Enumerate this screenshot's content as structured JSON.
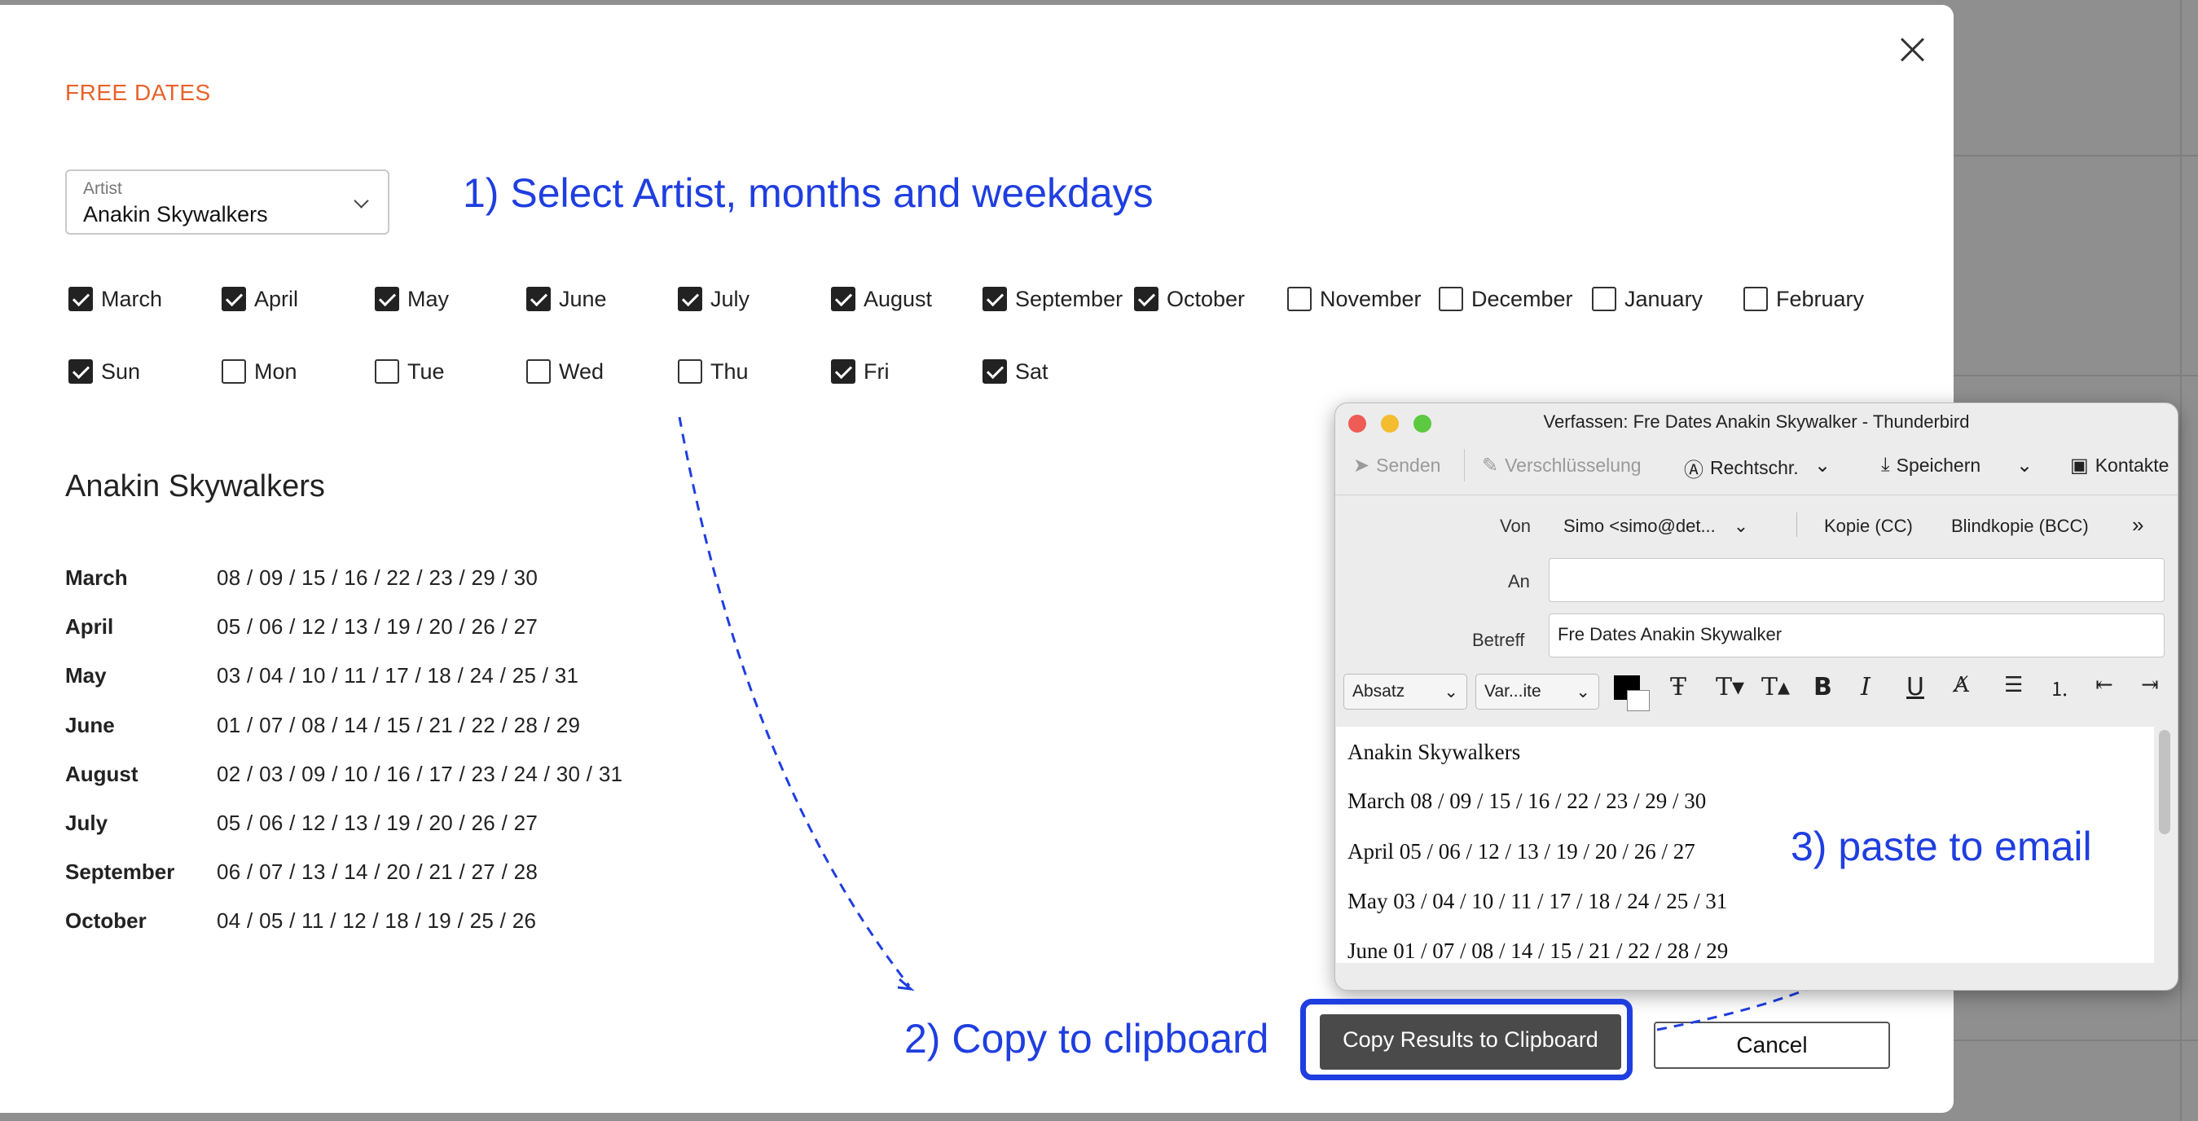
{
  "modal": {
    "title": "FREE DATES",
    "artist_label": "Artist",
    "artist_value": "Anakin Skywalkers",
    "months": [
      {
        "label": "March",
        "checked": true
      },
      {
        "label": "April",
        "checked": true
      },
      {
        "label": "May",
        "checked": true
      },
      {
        "label": "June",
        "checked": true
      },
      {
        "label": "July",
        "checked": true
      },
      {
        "label": "August",
        "checked": true
      },
      {
        "label": "September",
        "checked": true
      },
      {
        "label": "October",
        "checked": true
      },
      {
        "label": "November",
        "checked": false
      },
      {
        "label": "December",
        "checked": false
      },
      {
        "label": "January",
        "checked": false
      },
      {
        "label": "February",
        "checked": false
      }
    ],
    "weekdays": [
      {
        "label": "Sun",
        "checked": true
      },
      {
        "label": "Mon",
        "checked": false
      },
      {
        "label": "Tue",
        "checked": false
      },
      {
        "label": "Wed",
        "checked": false
      },
      {
        "label": "Thu",
        "checked": false
      },
      {
        "label": "Fri",
        "checked": true
      },
      {
        "label": "Sat",
        "checked": true
      }
    ],
    "results_heading": "Anakin Skywalkers",
    "results": [
      {
        "month": "March",
        "dates": "08 / 09 / 15 / 16 / 22 / 23 / 29 / 30"
      },
      {
        "month": "April",
        "dates": "05 / 06 / 12 / 13 / 19 / 20 / 26 / 27"
      },
      {
        "month": "May",
        "dates": "03 / 04 / 10 / 11 / 17 / 18 / 24 / 25 / 31"
      },
      {
        "month": "June",
        "dates": "01 / 07 / 08 / 14 / 15 / 21 / 22 / 28 / 29"
      },
      {
        "month": "August",
        "dates": "02 / 03 / 09 / 10 / 16 / 17 / 23 / 24 / 30 / 31"
      },
      {
        "month": "July",
        "dates": "05 / 06 / 12 / 13 / 19 / 20 / 26 / 27"
      },
      {
        "month": "September",
        "dates": "06 / 07 / 13 / 14 / 20 / 21 / 27 / 28"
      },
      {
        "month": "October",
        "dates": "04 / 05 / 11 / 12 / 18 / 19 / 25 / 26"
      }
    ],
    "copy_button": "Copy Results to Clipboard",
    "cancel_button": "Cancel"
  },
  "annotations": {
    "step1": "1) Select Artist, months and weekdays",
    "step2": "2) Copy to clipboard",
    "step3": "3) paste to email",
    "color": "#1f3ee0"
  },
  "thunderbird": {
    "window_title": "Verfassen: Fre Dates Anakin Skywalker - Thunderbird",
    "toolbar": {
      "send": "Senden",
      "encrypt": "Verschlüsselung",
      "spelling": "Rechtschr.",
      "save": "Speichern",
      "contacts": "Kontakte"
    },
    "from_label": "Von",
    "from_value": "Simo <simo@det...",
    "cc_label": "Kopie (CC)",
    "bcc_label": "Blindkopie (BCC)",
    "to_label": "An",
    "to_value": "",
    "subject_label": "Betreff",
    "subject_value": "Fre Dates Anakin Skywalker",
    "paragraph_style": "Absatz",
    "font_style": "Var...ite",
    "body_lines": [
      "Anakin Skywalkers",
      "March 08 / 09 / 15 / 16 / 22 / 23 / 29 / 30",
      "April 05 / 06 / 12 / 13 / 19 / 20 / 26 / 27",
      "May 03 / 04 / 10 / 11 / 17 / 18 / 24 / 25 / 31",
      "June 01 / 07 / 08 / 14 / 15 / 21 / 22 / 28 / 29"
    ]
  },
  "colors": {
    "title_orange": "#e8622a",
    "highlight_blue": "#1f3ee0",
    "copy_button_bg": "#4a4a4a"
  }
}
